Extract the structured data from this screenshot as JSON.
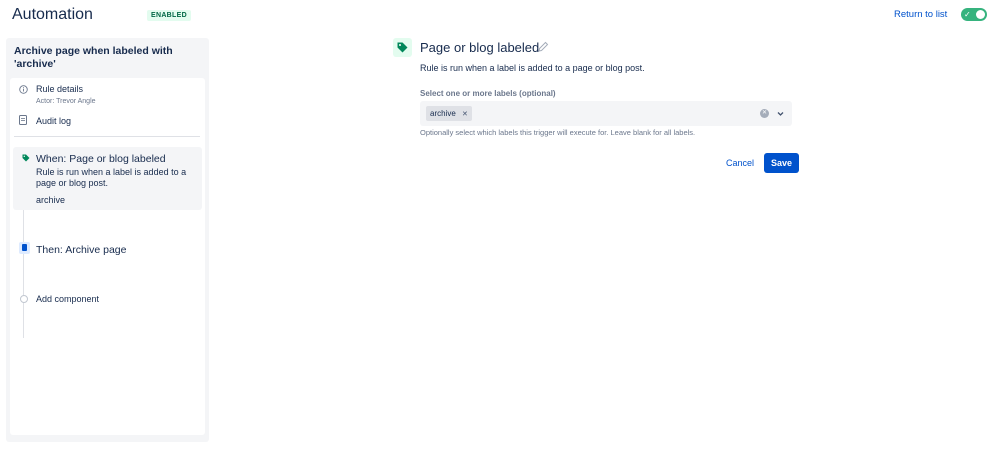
{
  "header": {
    "title": "Automation",
    "status_badge": "ENABLED",
    "return_link": "Return to list",
    "toggle": {
      "enabled": true
    }
  },
  "sidebar": {
    "rule_title": "Archive page when labeled with 'archive'",
    "items": [
      {
        "label": "Rule details",
        "sublabel": "Actor: Trevor Angle",
        "icon": "info-icon"
      },
      {
        "label": "Audit log",
        "icon": "document-icon"
      }
    ],
    "steps": {
      "when": {
        "title": "When: Page or blog labeled",
        "description": "Rule is run when a label is added to a page or blog post.",
        "tag": "archive",
        "icon": "tag-icon"
      },
      "then": {
        "title": "Then: Archive page",
        "icon": "archive-page-icon"
      },
      "add": {
        "label": "Add component",
        "icon": "circle-icon"
      }
    }
  },
  "main": {
    "title": "Page or blog labeled",
    "description": "Rule is run when a label is added to a page or blog post.",
    "field_label": "Select one or more labels (optional)",
    "selected_labels": [
      "archive"
    ],
    "helper_text": "Optionally select which labels this trigger will execute for. Leave blank for all labels.",
    "cancel_label": "Cancel",
    "save_label": "Save"
  },
  "colors": {
    "accent": "#0052cc",
    "toggle_on": "#36b37e",
    "tag_green": "#00875a"
  }
}
